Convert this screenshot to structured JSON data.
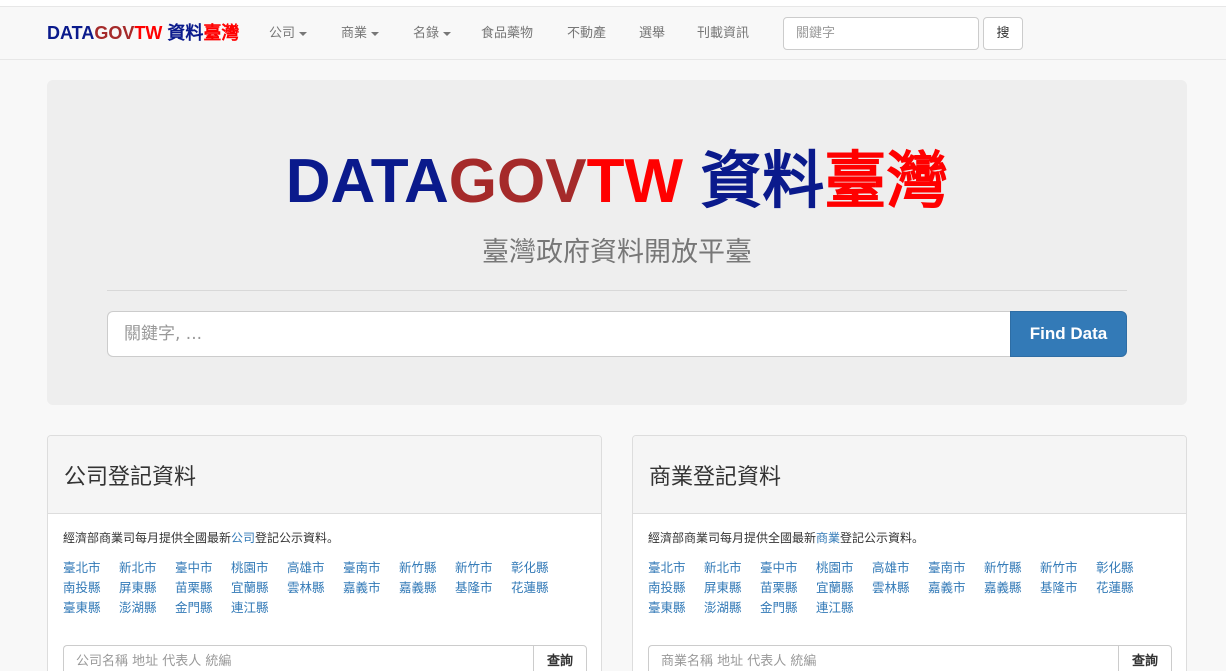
{
  "brand": {
    "part1": "DATA",
    "part2": "GOV",
    "part3": "TW",
    "part4": " 資料",
    "part5": "臺灣"
  },
  "nav": {
    "items": [
      "公司",
      "商業",
      "名錄",
      "食品藥物",
      "不動產",
      "選舉",
      "刊載資訊"
    ],
    "search_placeholder": "關鍵字",
    "search_button": "搜"
  },
  "hero": {
    "title1": "DATA",
    "title2": "GOV",
    "title3": "TW",
    "title4": " 資料",
    "title5": "臺灣",
    "subtitle": "臺灣政府資料開放平臺",
    "search_placeholder": "關鍵字, ...",
    "button": "Find Data"
  },
  "company_panel": {
    "title": "公司登記資料",
    "desc_prefix": "經濟部商業司每月提供全國最新",
    "desc_link": "公司",
    "desc_suffix": "登記公示資料。",
    "cities": [
      "臺北市",
      "新北市",
      "臺中市",
      "桃園市",
      "高雄市",
      "臺南市",
      "新竹縣",
      "新竹市",
      "彰化縣",
      "南投縣",
      "屏東縣",
      "苗栗縣",
      "宜蘭縣",
      "雲林縣",
      "嘉義市",
      "嘉義縣",
      "基隆市",
      "花蓮縣",
      "臺東縣",
      "澎湖縣",
      "金門縣",
      "連江縣"
    ],
    "search_placeholder": "公司名稱 地址 代表人 統編",
    "button": "查詢"
  },
  "business_panel": {
    "title": "商業登記資料",
    "desc_prefix": "經濟部商業司每月提供全國最新",
    "desc_link": "商業",
    "desc_suffix": "登記公示資料。",
    "cities": [
      "臺北市",
      "新北市",
      "臺中市",
      "桃園市",
      "高雄市",
      "臺南市",
      "新竹縣",
      "新竹市",
      "彰化縣",
      "南投縣",
      "屏東縣",
      "苗栗縣",
      "宜蘭縣",
      "雲林縣",
      "嘉義市",
      "嘉義縣",
      "基隆市",
      "花蓮縣",
      "臺東縣",
      "澎湖縣",
      "金門縣",
      "連江縣"
    ],
    "search_placeholder": "商業名稱 地址 代表人 統編",
    "button": "查詢"
  },
  "colors": {
    "navy": "#0a1a8c",
    "maroon": "#a52a2a",
    "red": "#ff0000",
    "link": "#337ab7",
    "primary": "#337ab7"
  }
}
